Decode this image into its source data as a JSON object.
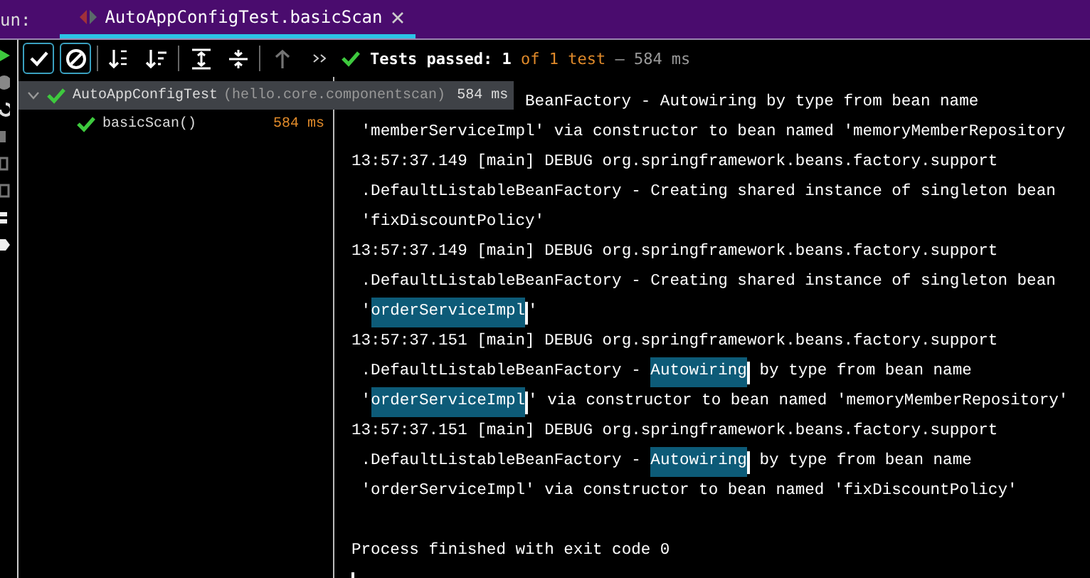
{
  "header": {
    "label": "un:",
    "tab": {
      "title": "AutoAppConfigTest.basicScan",
      "selected": true
    }
  },
  "toolbar": {
    "buttons": [
      {
        "kind": "check",
        "selected": true
      },
      {
        "kind": "stop",
        "selected": true
      },
      {
        "kind": "sort-alpha",
        "selected": false
      },
      {
        "kind": "sort-duration",
        "selected": false
      },
      {
        "kind": "expand",
        "selected": false
      },
      {
        "kind": "collapse",
        "selected": false
      },
      {
        "kind": "up",
        "selected": false,
        "disabled": true
      },
      {
        "kind": "more",
        "selected": false
      }
    ],
    "status": {
      "label": "Tests passed: ",
      "count": "1",
      "total": " of 1 test",
      "duration": " – 584 ms"
    }
  },
  "tree": [
    {
      "name": "AutoAppConfigTest",
      "package": "(hello.core.componentscan)",
      "time": "584 ms",
      "selected": true,
      "expanded": true,
      "children": [
        {
          "name": "basicScan()",
          "time": "584 ms",
          "selected": false
        }
      ]
    }
  ],
  "console": {
    "lines": [
      {
        "kind": "cut",
        "parts": [
          {
            "text": "BeanFactory - Autowiring by type from bean name",
            "highlighted": false
          }
        ]
      },
      {
        "kind": "text",
        "parts": [
          {
            "text": " 'memberServiceImpl' via constructor to bean named 'memoryMemberRepository",
            "highlighted": false
          }
        ]
      },
      {
        "kind": "text",
        "parts": [
          {
            "text": "13:57:37.149 [main] DEBUG org.springframework.beans.factory.support",
            "highlighted": false
          }
        ]
      },
      {
        "kind": "text",
        "parts": [
          {
            "text": " .DefaultListableBeanFactory - Creating shared instance of singleton bean",
            "highlighted": false
          }
        ]
      },
      {
        "kind": "text",
        "parts": [
          {
            "text": " 'fixDiscountPolicy'",
            "highlighted": false
          }
        ]
      },
      {
        "kind": "text",
        "parts": [
          {
            "text": "13:57:37.149 [main] DEBUG org.springframework.beans.factory.support",
            "highlighted": false
          }
        ]
      },
      {
        "kind": "text",
        "parts": [
          {
            "text": " .DefaultListableBeanFactory - Creating shared instance of singleton bean",
            "highlighted": false
          }
        ]
      },
      {
        "kind": "text",
        "parts": [
          {
            "text": " '",
            "highlighted": false
          },
          {
            "text": "orderServiceImpl",
            "highlighted": true
          },
          {
            "text": "'",
            "highlighted": false
          }
        ]
      },
      {
        "kind": "text",
        "parts": [
          {
            "text": "13:57:37.151 [main] DEBUG org.springframework.beans.factory.support",
            "highlighted": false
          }
        ]
      },
      {
        "kind": "text",
        "parts": [
          {
            "text": " .DefaultListableBeanFactory - ",
            "highlighted": false
          },
          {
            "text": "Autowiring",
            "highlighted": true
          },
          {
            "text": " by type from bean name",
            "highlighted": false
          }
        ]
      },
      {
        "kind": "text",
        "parts": [
          {
            "text": " '",
            "highlighted": false
          },
          {
            "text": "orderServiceImpl",
            "highlighted": true
          },
          {
            "text": "' via constructor to bean named 'memoryMemberRepository'",
            "highlighted": false
          }
        ]
      },
      {
        "kind": "text",
        "parts": [
          {
            "text": "13:57:37.151 [main] DEBUG org.springframework.beans.factory.support",
            "highlighted": false
          }
        ]
      },
      {
        "kind": "text",
        "parts": [
          {
            "text": " .DefaultListableBeanFactory - ",
            "highlighted": false
          },
          {
            "text": "Autowiring",
            "highlighted": true
          },
          {
            "text": " by type from bean name",
            "highlighted": false
          }
        ]
      },
      {
        "kind": "text",
        "parts": [
          {
            "text": " 'orderServiceImpl' via constructor to bean named 'fixDiscountPolicy'",
            "highlighted": false
          }
        ]
      },
      {
        "kind": "blank"
      },
      {
        "kind": "text",
        "parts": [
          {
            "text": "Process finished with exit code 0",
            "highlighted": false
          }
        ]
      },
      {
        "kind": "cursor"
      }
    ]
  }
}
